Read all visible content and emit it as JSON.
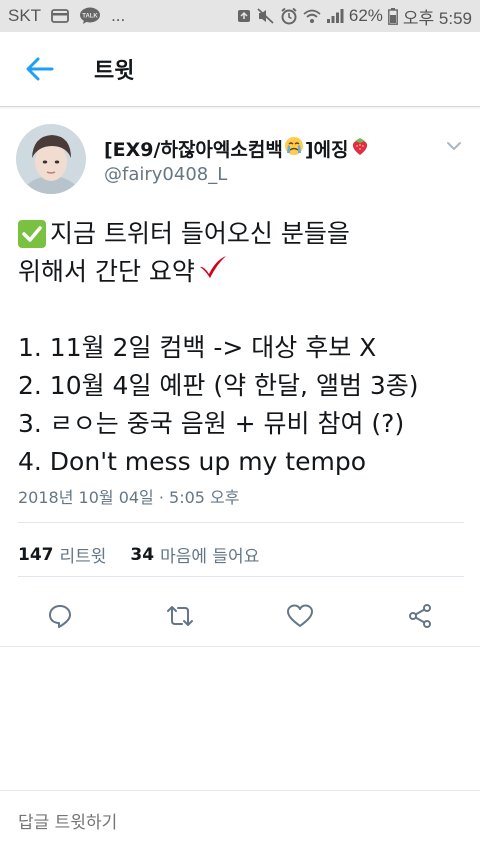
{
  "status_bar": {
    "carrier": "SKT",
    "battery": "62%",
    "time": "오후 5:59",
    "talk_label": "TALK",
    "more": "..."
  },
  "header": {
    "title": "트윗"
  },
  "tweet": {
    "author_name_prefix": "[EX9/하잖아엑소컴백",
    "author_name_suffix": "]에징",
    "handle": "@fairy0408_L",
    "lines": [
      "지금 트위터 들어오신 분들을",
      "위해서 간단 요약",
      "",
      "1. 11월 2일 컴백 -> 대상 후보 X",
      "2. 10월 4일 예판 (약 한달, 앨범 3종)",
      "3. ㄹㅇ는 중국 음원 + 뮤비 참여 (?)",
      "4. Don't mess up my tempo"
    ],
    "timestamp": "2018년 10월 04일 · 5:05 오후",
    "retweets_count": "147",
    "retweets_label": "리트윗",
    "likes_count": "34",
    "likes_label": "마음에 들어요"
  },
  "reply": {
    "placeholder": "답글 트윗하기"
  },
  "colors": {
    "accent": "#1da1f2",
    "icon_gray": "#657786",
    "check_green": "#7ac142",
    "check_red": "#d0021b"
  }
}
